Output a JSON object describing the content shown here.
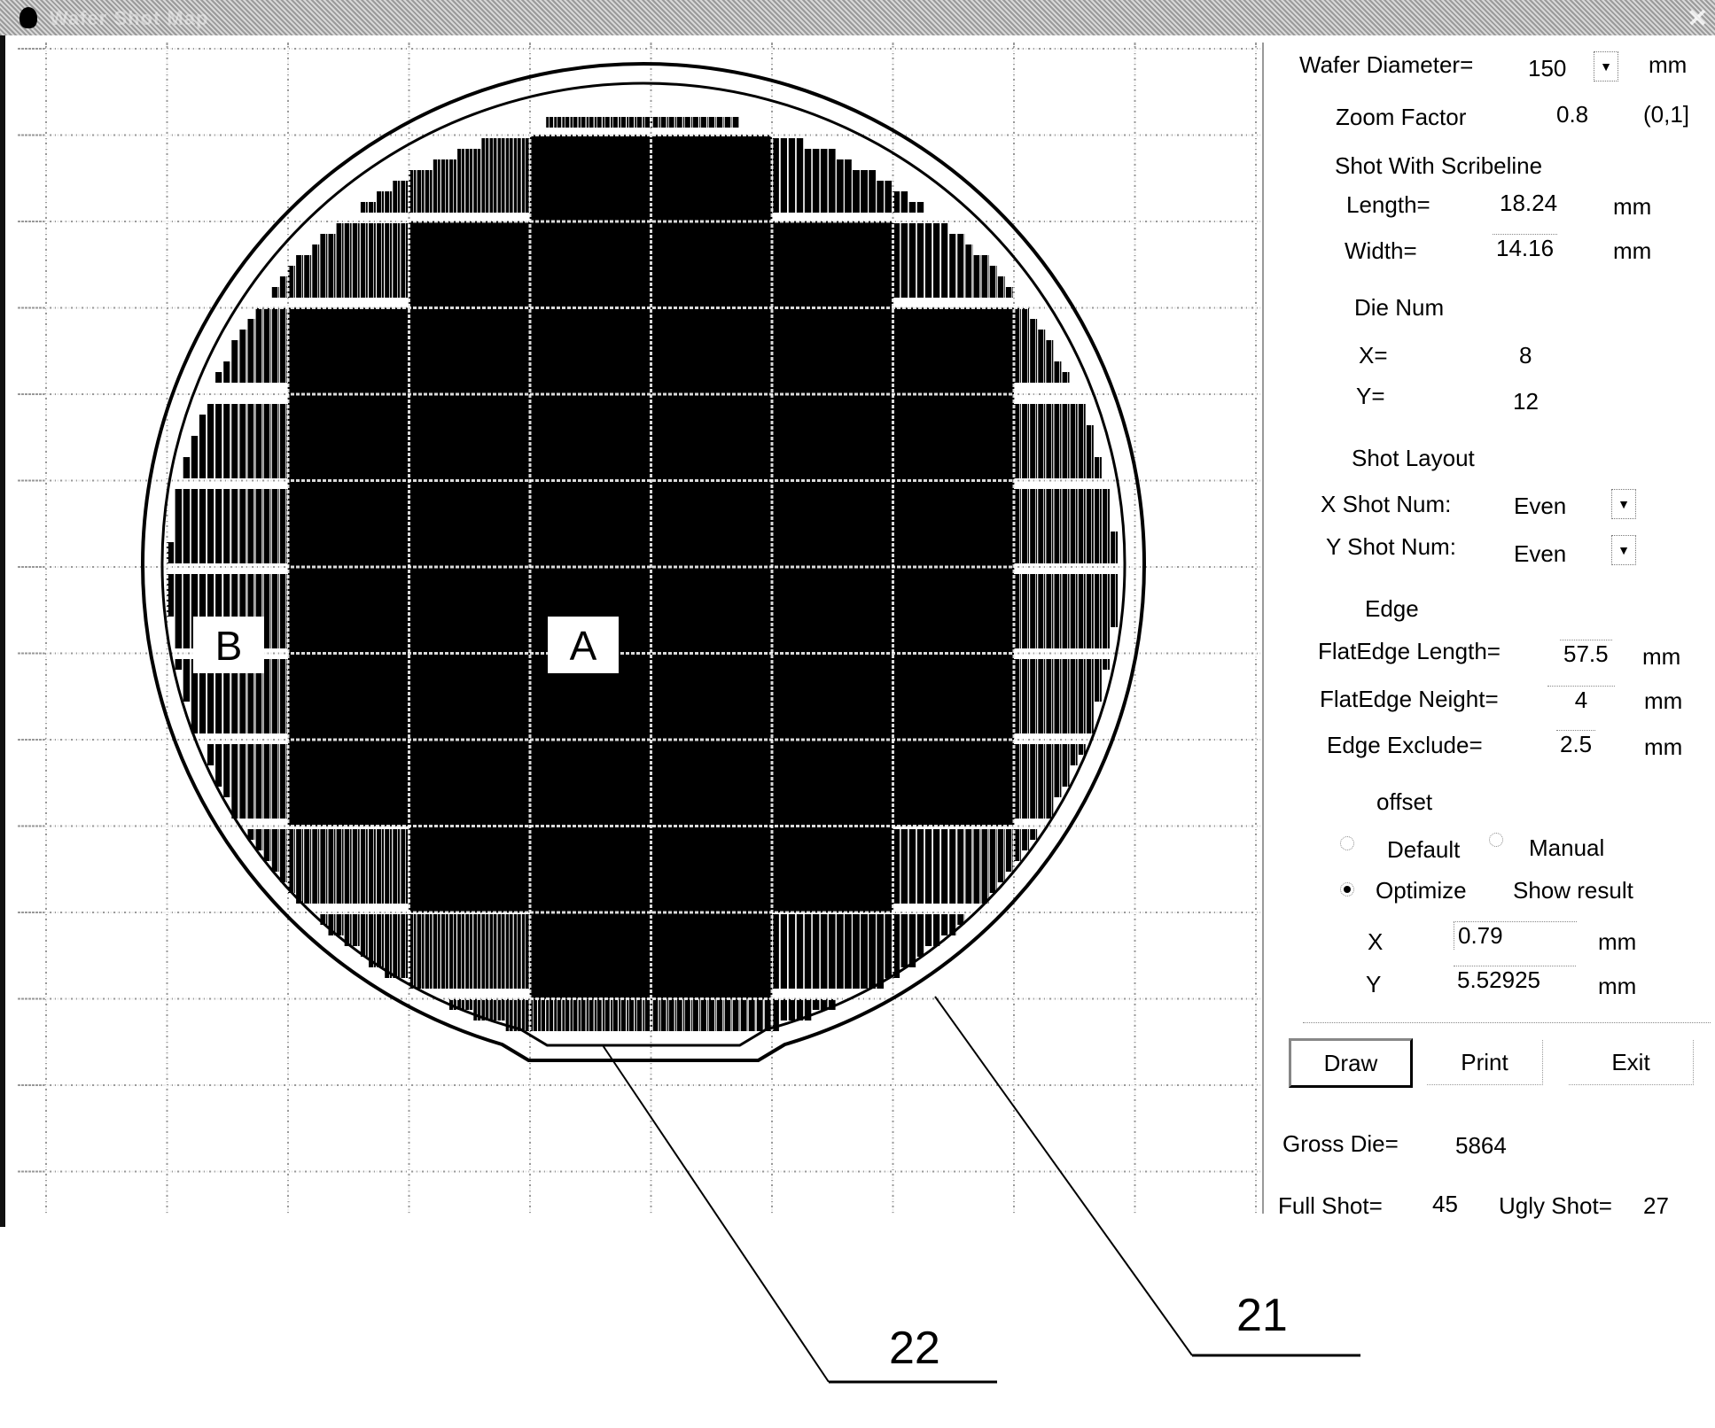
{
  "window": {
    "title": "Wafer Shot Map",
    "close_icon": "✕"
  },
  "map": {
    "labels": {
      "region_a": "A",
      "region_b": "B"
    },
    "callouts": {
      "wafer_edge": "21",
      "flat_edge": "22"
    }
  },
  "panel": {
    "wafer_diameter": {
      "label": "Wafer Diameter=",
      "value": "150",
      "unit": "mm"
    },
    "zoom_factor": {
      "label": "Zoom Factor",
      "value": "0.8",
      "range": "(0,1]"
    },
    "shot_scribeline": {
      "title": "Shot With Scribeline",
      "length": {
        "label": "Length=",
        "value": "18.24",
        "unit": "mm"
      },
      "width": {
        "label": "Width=",
        "value": "14.16",
        "unit": "mm"
      }
    },
    "die_num": {
      "title": "Die Num",
      "x": {
        "label": "X=",
        "value": "8"
      },
      "y": {
        "label": "Y=",
        "value": "12"
      }
    },
    "shot_layout": {
      "title": "Shot Layout",
      "x_shot": {
        "label": "X Shot Num:",
        "value": "Even"
      },
      "y_shot": {
        "label": "Y Shot Num:",
        "value": "Even"
      }
    },
    "edge": {
      "title": "Edge",
      "flat_length": {
        "label": "FlatEdge Length=",
        "value": "57.5",
        "unit": "mm"
      },
      "flat_height": {
        "label": "FlatEdge Neight=",
        "value": "4",
        "unit": "mm"
      },
      "exclude": {
        "label": "Edge Exclude=",
        "value": "2.5",
        "unit": "mm"
      }
    },
    "offset": {
      "title": "offset",
      "default_label": "Default",
      "manual_label": "Manual",
      "optimize_label": "Optimize",
      "selected": "Optimize",
      "show_result_label": "Show result",
      "x": {
        "label": "X",
        "value": "0.79",
        "unit": "mm"
      },
      "y": {
        "label": "Y",
        "value": "5.52925",
        "unit": "mm"
      }
    },
    "buttons": {
      "draw": "Draw",
      "print": "Print",
      "exit": "Exit"
    },
    "results": {
      "gross_die_label": "Gross Die=",
      "gross_die": "5864",
      "full_shot_label": "Full Shot=",
      "full_shot": "45",
      "ugly_shot_label": "Ugly Shot=",
      "ugly_shot": "27"
    }
  }
}
